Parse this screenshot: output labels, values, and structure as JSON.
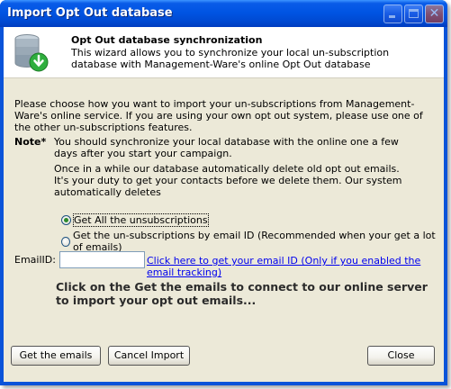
{
  "window": {
    "title": "Import Opt Out database"
  },
  "header": {
    "title": "Opt Out database synchronization",
    "description": "This wizard allows you to synchronize your local un-subscription database with Management-Ware's online Opt Out database",
    "icon": "database-sync-icon"
  },
  "intro": "Please choose how you want to import your un-subscriptions from Management-Ware's online service. If you are using your own opt out system, please use one of the other un-subscriptions features.",
  "note": {
    "label": "Note*",
    "line1": "You should synchronize your local database with the online one a few days after you start your campaign.",
    "line2": "Once in a while our database automatically delete old opt out emails. It's your duty to get your contacts before we delete them. Our system automatically deletes"
  },
  "options": [
    {
      "label": "Get All the unsubscriptions",
      "selected": true
    },
    {
      "label": "Get the un-subscriptions by email ID (Recommended when your get a lot of emails)",
      "selected": false
    }
  ],
  "email": {
    "label": "EmailID:",
    "value": "",
    "link": "Click here to get your email ID (Only if you enabled the email tracking)"
  },
  "instruction": "Click on the Get the emails to connect to our online server to import your opt out emails...",
  "buttons": {
    "get": "Get the emails",
    "cancel": "Cancel Import",
    "close": "Close"
  },
  "colors": {
    "titlebar": "#0054e3",
    "client": "#ece9d8",
    "link": "#0000ee"
  }
}
